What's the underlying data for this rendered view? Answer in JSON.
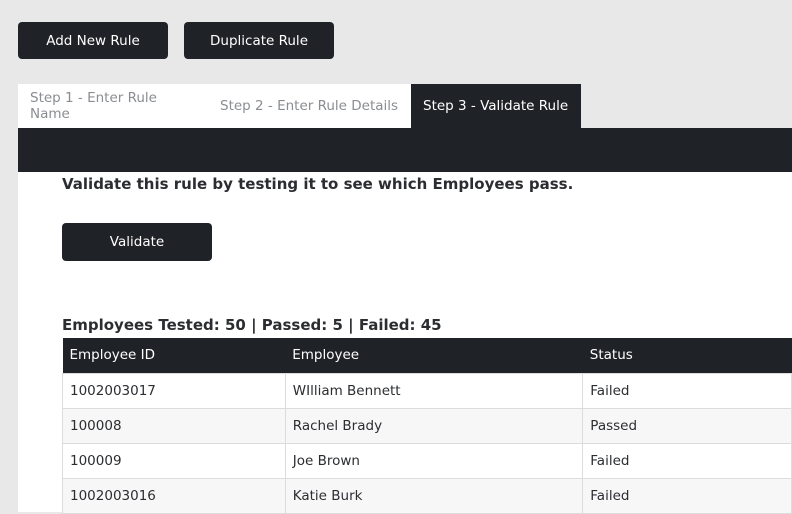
{
  "toolbar": {
    "add_label": "Add New Rule",
    "duplicate_label": "Duplicate Rule"
  },
  "tabs": [
    {
      "label": "Step 1 - Enter Rule Name",
      "active": false
    },
    {
      "label": "Step 2 - Enter Rule Details",
      "active": false
    },
    {
      "label": "Step 3 - Validate Rule",
      "active": true
    }
  ],
  "validate": {
    "instruction": "Validate this rule by testing it to see which Employees pass.",
    "button_label": "Validate",
    "summary": "Employees Tested: 50 | Passed: 5 | Failed: 45"
  },
  "table": {
    "headers": [
      "Employee ID",
      "Employee",
      "Status"
    ],
    "rows": [
      [
        "1002003017",
        "WIlliam Bennett",
        "Failed"
      ],
      [
        "100008",
        "Rachel Brady",
        "Passed"
      ],
      [
        "100009",
        "Joe Brown",
        "Failed"
      ],
      [
        "1002003016",
        "Katie Burk",
        "Failed"
      ]
    ]
  }
}
